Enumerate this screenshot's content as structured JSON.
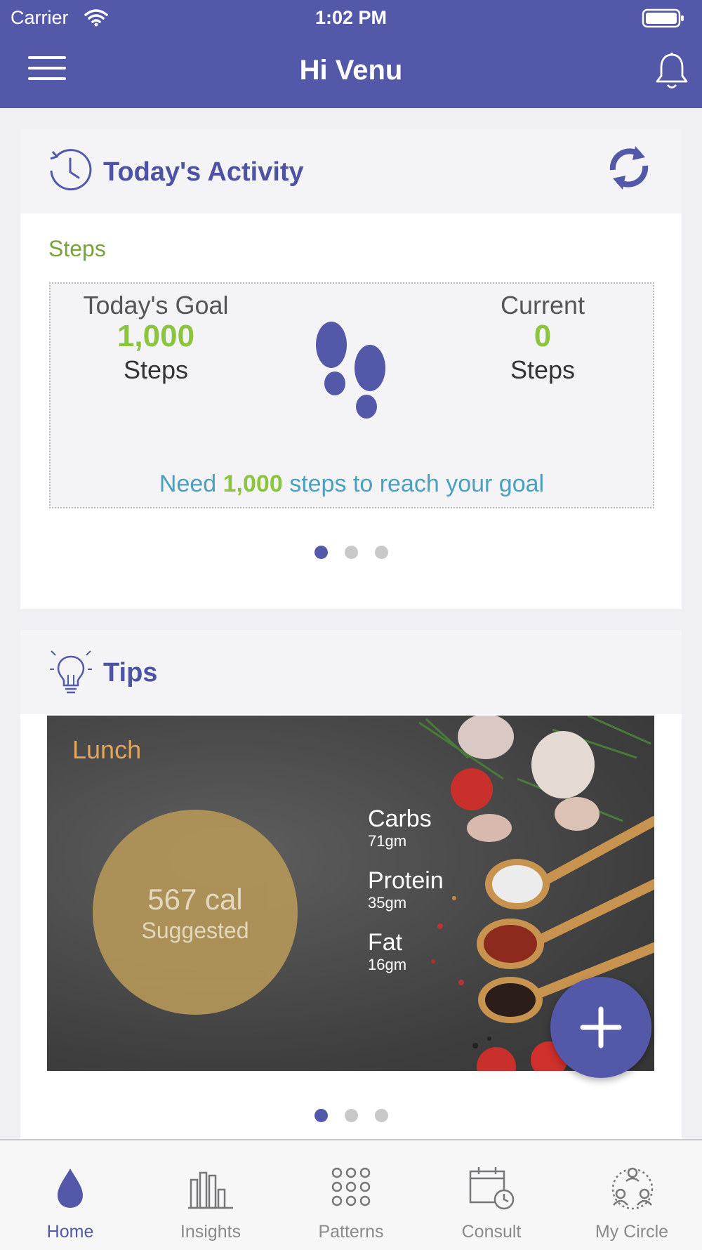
{
  "status": {
    "carrier": "Carrier",
    "time": "1:02 PM"
  },
  "header": {
    "title": "Hi Venu"
  },
  "activity": {
    "title": "Today's Activity",
    "section": "Steps",
    "goal_label": "Today's Goal",
    "goal_value": "1,000",
    "goal_unit": "Steps",
    "current_label": "Current",
    "current_value": "0",
    "current_unit": "Steps",
    "need_prefix": "Need",
    "need_value": "1,000",
    "need_suffix": "steps to reach your goal",
    "page_index": 1,
    "page_count": 3
  },
  "tips": {
    "title": "Tips",
    "meal": "Lunch",
    "calories": "567 cal",
    "calories_sub": "Suggested",
    "macros": [
      {
        "name": "Carbs",
        "value": "71gm"
      },
      {
        "name": "Protein",
        "value": "35gm"
      },
      {
        "name": "Fat",
        "value": "16gm"
      }
    ],
    "page_index": 1,
    "page_count": 3
  },
  "tabs": [
    {
      "label": "Home",
      "icon": "drop-icon",
      "active": true
    },
    {
      "label": "Insights",
      "icon": "bar-chart-icon",
      "active": false
    },
    {
      "label": "Patterns",
      "icon": "dots-grid-icon",
      "active": false
    },
    {
      "label": "Consult",
      "icon": "calendar-clock-icon",
      "active": false
    },
    {
      "label": "My Circle",
      "icon": "people-circle-icon",
      "active": false
    }
  ],
  "colors": {
    "primary": "#5358a9",
    "green": "#8bc53f",
    "steps_label": "#78a33d",
    "need_text": "#4aa0bd",
    "meal": "#e2a65b"
  }
}
